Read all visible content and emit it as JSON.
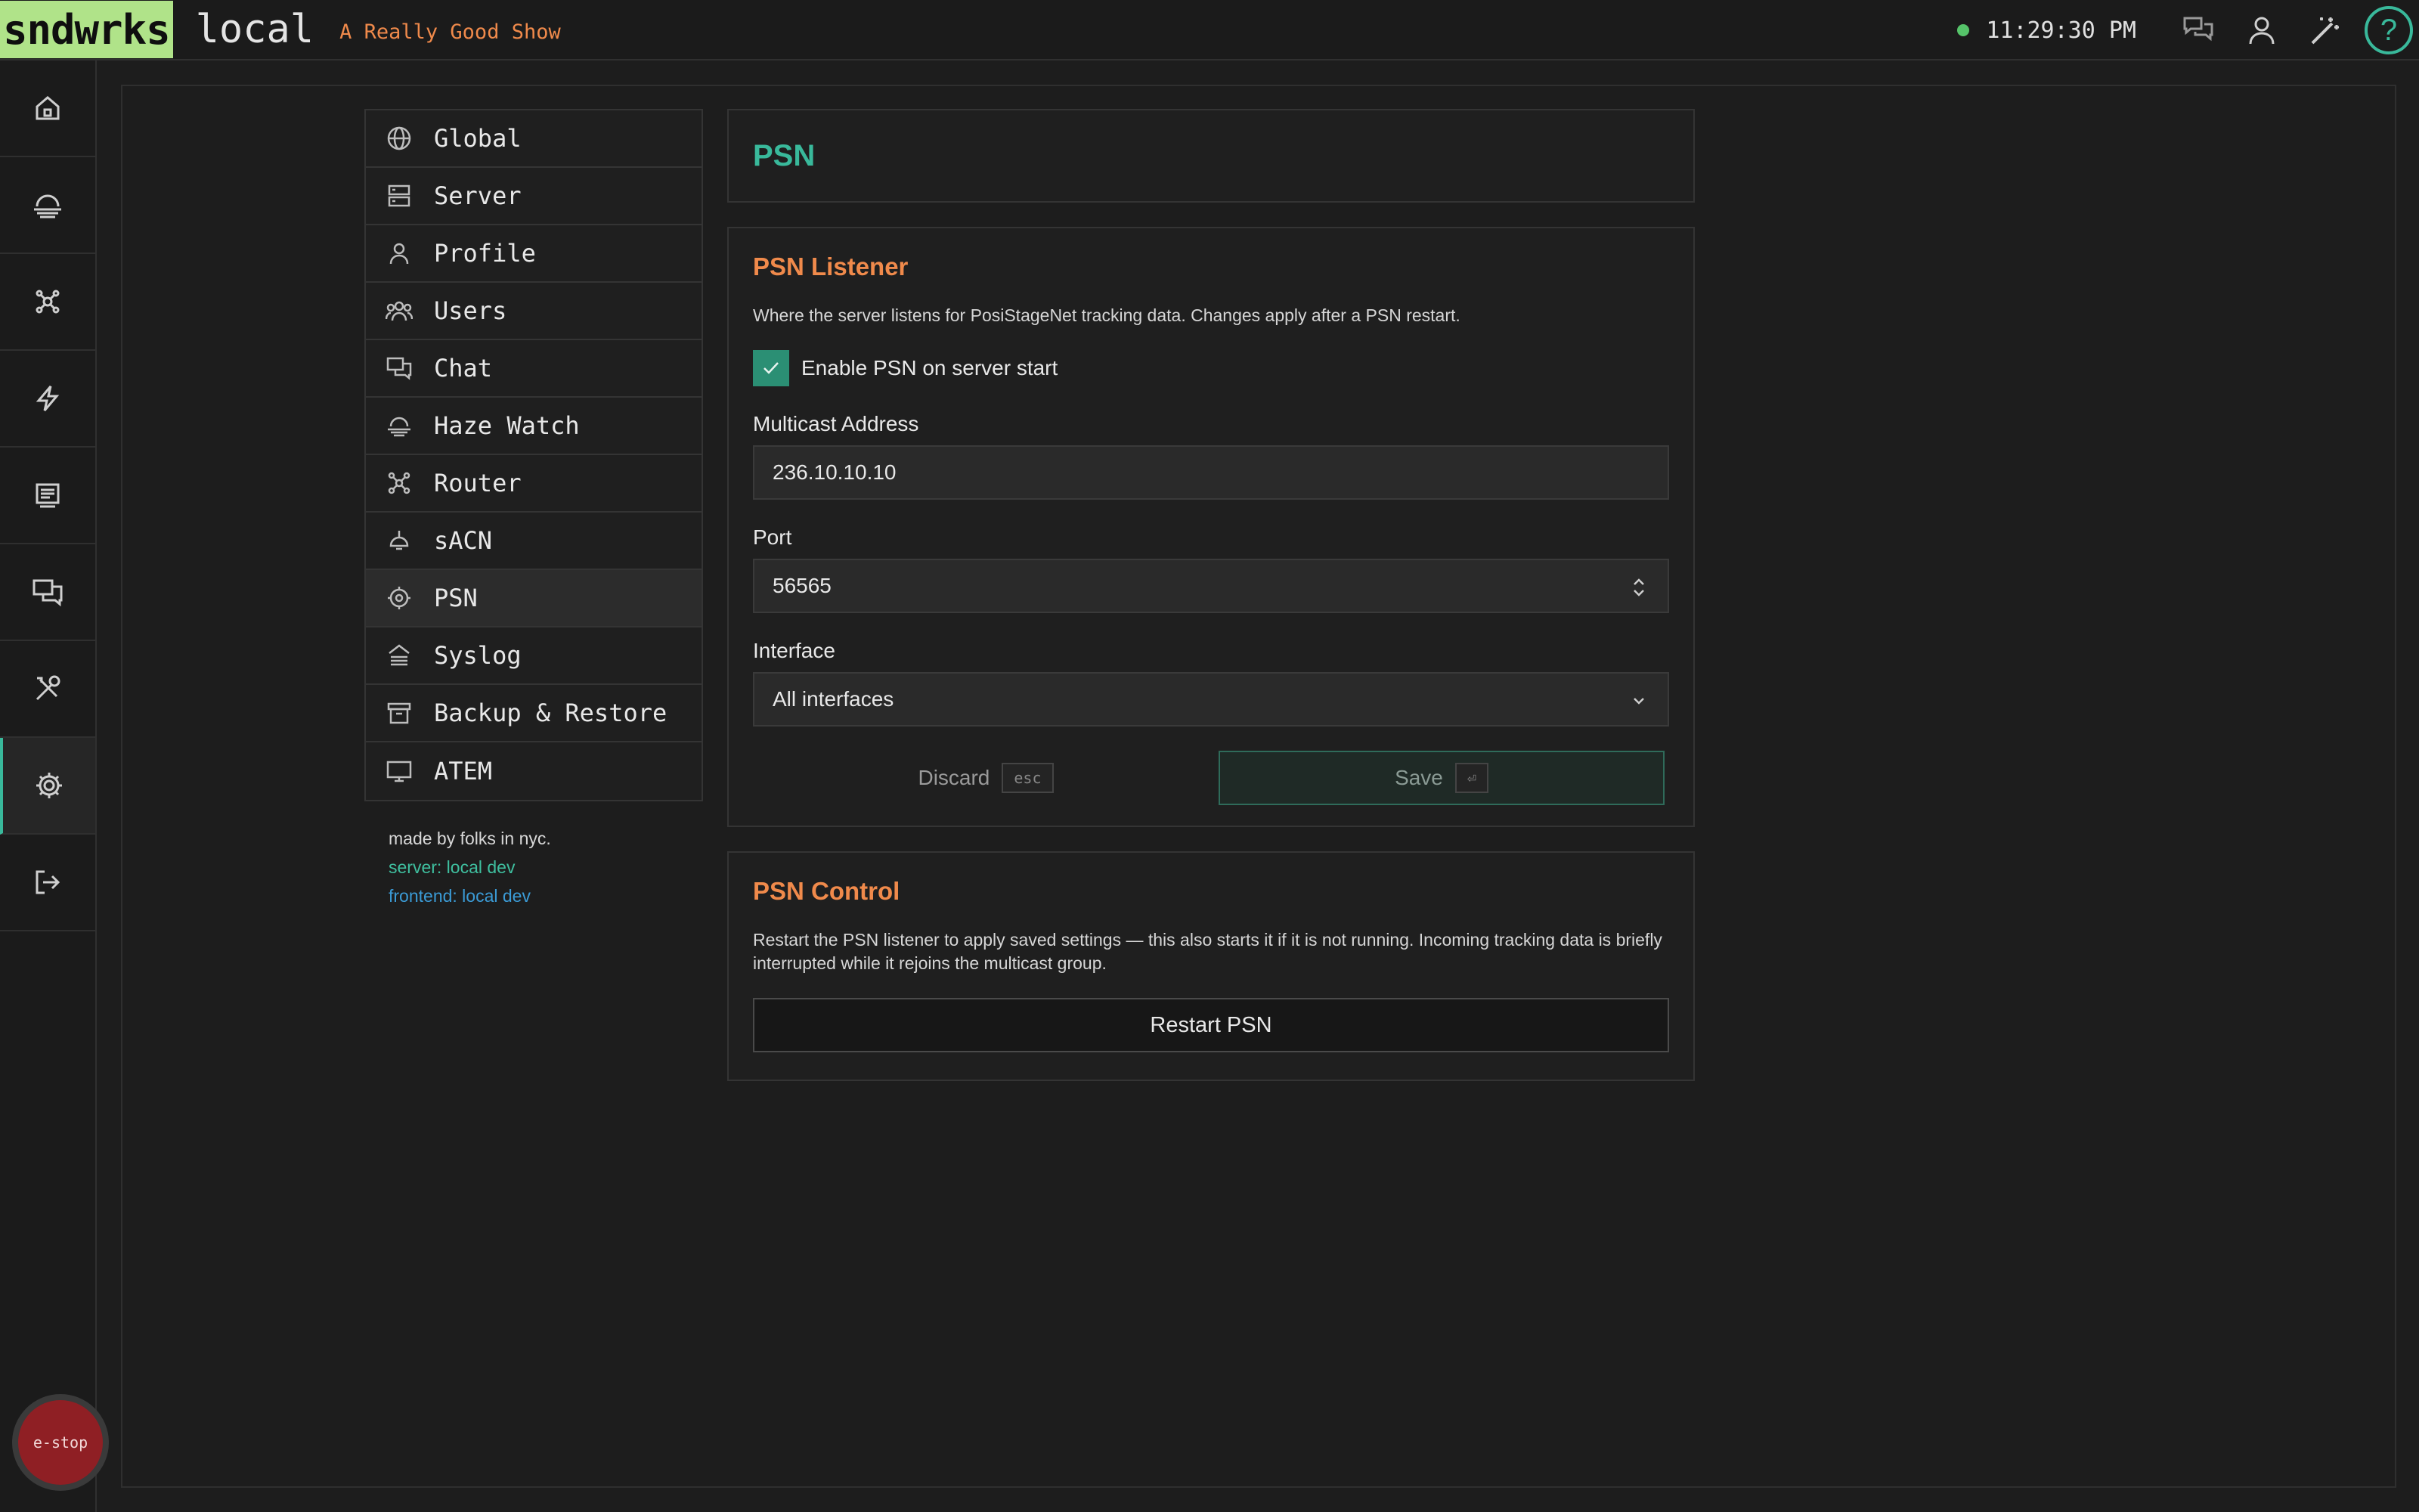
{
  "topbar": {
    "logo": "sndwrks",
    "site": "local",
    "show": "A Really Good Show",
    "clock": "11:29:30 PM",
    "help": "?"
  },
  "leftnav": [
    "home-icon",
    "haze-icon",
    "router-icon",
    "lightning-icon",
    "display-icon",
    "chat-icon",
    "tools-icon",
    "gear-icon",
    "logout-icon"
  ],
  "estop": "e-stop",
  "menu": {
    "items": [
      {
        "label": "Global",
        "icon": "globe-icon"
      },
      {
        "label": "Server",
        "icon": "server-icon"
      },
      {
        "label": "Profile",
        "icon": "user-icon"
      },
      {
        "label": "Users",
        "icon": "users-icon"
      },
      {
        "label": "Chat",
        "icon": "chat-icon"
      },
      {
        "label": "Haze Watch",
        "icon": "haze-icon"
      },
      {
        "label": "Router",
        "icon": "router-icon"
      },
      {
        "label": "sACN",
        "icon": "lamp-icon"
      },
      {
        "label": "PSN",
        "icon": "target-icon"
      },
      {
        "label": "Syslog",
        "icon": "syslog-icon"
      },
      {
        "label": "Backup & Restore",
        "icon": "archive-icon"
      },
      {
        "label": "ATEM",
        "icon": "monitor-icon"
      }
    ],
    "active": "PSN"
  },
  "credits": {
    "made": "made by folks in nyc.",
    "server": "server: local dev",
    "frontend": "frontend: local dev"
  },
  "page": {
    "title": "PSN"
  },
  "listener": {
    "title": "PSN Listener",
    "description": "Where the server listens for PosiStageNet tracking data. Changes apply after a PSN restart.",
    "enable_label": "Enable PSN on server start",
    "enable_checked": true,
    "multicast_label": "Multicast Address",
    "multicast_value": "236.10.10.10",
    "port_label": "Port",
    "port_value": "56565",
    "interface_label": "Interface",
    "interface_value": "All interfaces",
    "discard_label": "Discard",
    "discard_key": "esc",
    "save_label": "Save",
    "save_key": "⏎"
  },
  "control": {
    "title": "PSN Control",
    "description": "Restart the PSN listener to apply saved settings — this also starts it if it is not running. Incoming tracking data is briefly interrupted while it rejoins the multicast group.",
    "restart_label": "Restart PSN"
  },
  "colors": {
    "accent": "#39b99b",
    "orange": "#f08a4b",
    "logo_bg": "#b0e389",
    "estop": "#8f1f24"
  }
}
